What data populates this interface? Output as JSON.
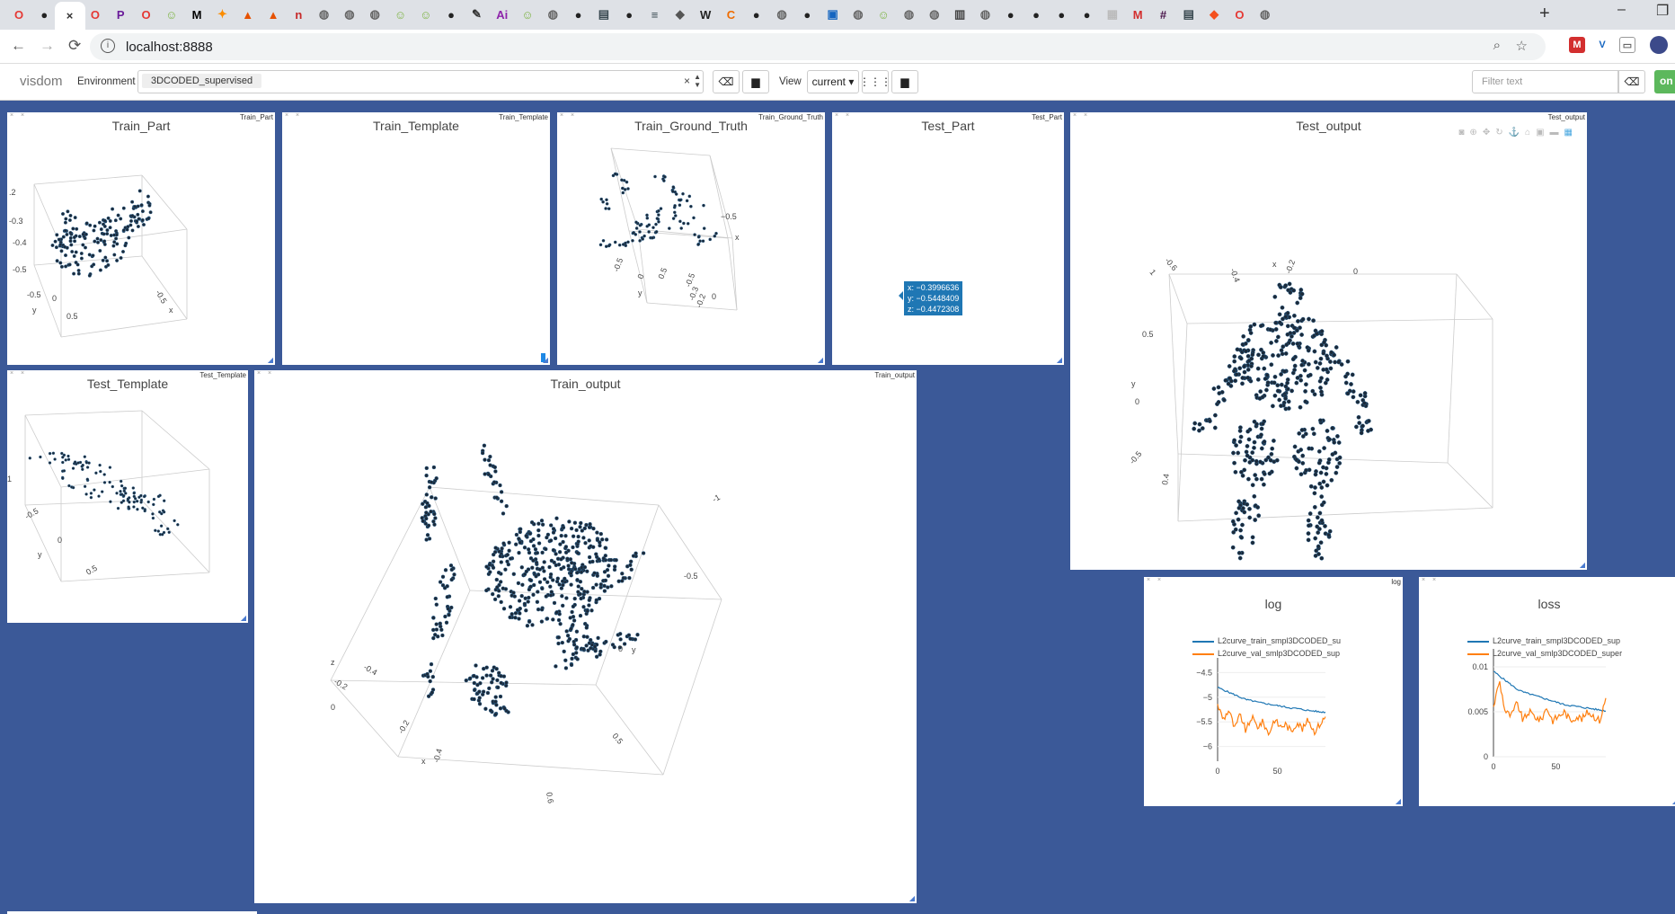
{
  "browser": {
    "url": "localhost:8888",
    "tab_icons": [
      "opera-icon",
      "github-icon",
      "active-tab",
      "opera-icon",
      "p-icon",
      "opera-icon",
      "smiley-icon",
      "medium-icon",
      "runner-icon",
      "matlab-icon",
      "matlab-icon",
      "n-icon",
      "globe-icon",
      "globe-icon",
      "globe-icon",
      "smiley-icon",
      "smiley-icon",
      "github-icon",
      "pen-icon",
      "ai-icon",
      "smiley-icon",
      "globe-icon",
      "github-icon",
      "doc-icon",
      "github-icon",
      "stripe-icon",
      "cube-icon",
      "wikipedia-icon",
      "c-icon",
      "github-icon",
      "globe-icon",
      "github-icon",
      "layout-icon",
      "globe-icon",
      "smiley-icon",
      "globe-icon",
      "globe-icon",
      "book-icon",
      "globe-icon",
      "github-icon",
      "github-icon",
      "github-icon",
      "github-icon",
      "gray-icon",
      "gmail-icon",
      "slack-icon",
      "doc-icon",
      "git-icon",
      "opera-icon",
      "globe-icon"
    ]
  },
  "toolbar": {
    "brand": "visdom",
    "environment_label": "Environment",
    "environment_value": "3DCODED_supervised",
    "clear_glyph": "×",
    "view_label": "View",
    "view_value": "current ▾",
    "filter_placeholder": "Filter text",
    "on_label": "on"
  },
  "panes": {
    "train_part": {
      "title": "Train_Part",
      "name": "Train_Part"
    },
    "train_template": {
      "title": "Train_Template",
      "name": "Train_Template"
    },
    "train_gt": {
      "title": "Train_Ground_Truth",
      "name": "Train_Ground_Truth"
    },
    "test_part": {
      "title": "Test_Part",
      "name": "Test_Part",
      "tooltip_x": "x: −0.3996636",
      "tooltip_y": "y: −0.5448409",
      "tooltip_z": "z: −0.4472308"
    },
    "test_output": {
      "title": "Test_output",
      "name": "Test_output"
    },
    "test_template": {
      "title": "Test_Template",
      "name": "Test_Template"
    },
    "train_output": {
      "title": "Train_output",
      "name": "Train_output"
    },
    "log": {
      "title": "log",
      "name": "log"
    },
    "loss": {
      "title": "loss",
      "name": "l"
    }
  },
  "axis_labels": {
    "train_part": [
      ".2",
      "-0.3",
      "-0.4",
      "-0.5",
      "-0.5",
      "0",
      "0.5",
      "y",
      "x",
      "-0.5"
    ],
    "train_gt": [
      "−0.5",
      "x",
      "-0.5",
      "0",
      "0.5",
      "y",
      "-0.5",
      "-0.3",
      "-0.2",
      "0"
    ],
    "test_output": [
      "-0.6",
      "-0.4",
      "x",
      "-0.2",
      "0",
      "1",
      "0.5",
      "y",
      "0",
      "-0.5",
      "0.4"
    ],
    "test_template": [
      "-0.5",
      "0",
      "y",
      "0.5",
      "1"
    ],
    "train_output": [
      "-1",
      "-0.5",
      "0",
      "y",
      "z",
      "-0.4",
      "-0.2",
      "0",
      "-0.2",
      "-0.4",
      "x",
      "0.5",
      "0.6"
    ]
  },
  "chart_data": [
    {
      "type": "line",
      "title": "log",
      "series": [
        {
          "name": "L2curve_train_smpl3DCODED_su",
          "color": "#1f77b4"
        },
        {
          "name": "L2curve_val_smlp3DCODED_sup",
          "color": "#ff7f0e"
        }
      ],
      "yticks": [
        "−4.5",
        "−5",
        "−5.5",
        "−6"
      ],
      "xticks": [
        "0",
        "50"
      ],
      "ylim": [
        -6.3,
        -4.2
      ],
      "xlim": [
        0,
        90
      ],
      "train_values": [
        -4.8,
        -4.85,
        -4.9,
        -4.95,
        -5.0,
        -5.05,
        -5.07,
        -5.1,
        -5.12,
        -5.14,
        -5.16,
        -5.18,
        -5.2,
        -5.22,
        -5.23,
        -5.25,
        -5.27,
        -5.28,
        -5.3,
        -5.3
      ],
      "val_values": [
        -5.15,
        -5.45,
        -5.25,
        -5.65,
        -5.35,
        -5.7,
        -5.4,
        -5.6,
        -5.5,
        -5.75,
        -5.45,
        -5.6,
        -5.55,
        -5.7,
        -5.5,
        -5.65,
        -5.45,
        -5.7,
        -5.55,
        -5.4
      ]
    },
    {
      "type": "line",
      "title": "loss",
      "series": [
        {
          "name": "L2curve_train_smpl3DCODED_sup",
          "color": "#1f77b4"
        },
        {
          "name": "L2curve_val_smlp3DCODED_super",
          "color": "#ff7f0e"
        }
      ],
      "yticks": [
        "0.01",
        "0.005",
        "0"
      ],
      "xticks": [
        "0",
        "50"
      ],
      "ylim": [
        0,
        0.012
      ],
      "xlim": [
        0,
        90
      ],
      "train_values": [
        0.0095,
        0.009,
        0.0085,
        0.008,
        0.0075,
        0.0072,
        0.007,
        0.0068,
        0.0066,
        0.0064,
        0.0062,
        0.006,
        0.0058,
        0.0057,
        0.0056,
        0.0055,
        0.0054,
        0.0053,
        0.0052,
        0.0051
      ],
      "val_values": [
        0.0055,
        0.0085,
        0.005,
        0.0045,
        0.006,
        0.004,
        0.005,
        0.0045,
        0.004,
        0.0055,
        0.004,
        0.0045,
        0.005,
        0.004,
        0.0045,
        0.0042,
        0.005,
        0.0045,
        0.004,
        0.0065
      ]
    }
  ]
}
